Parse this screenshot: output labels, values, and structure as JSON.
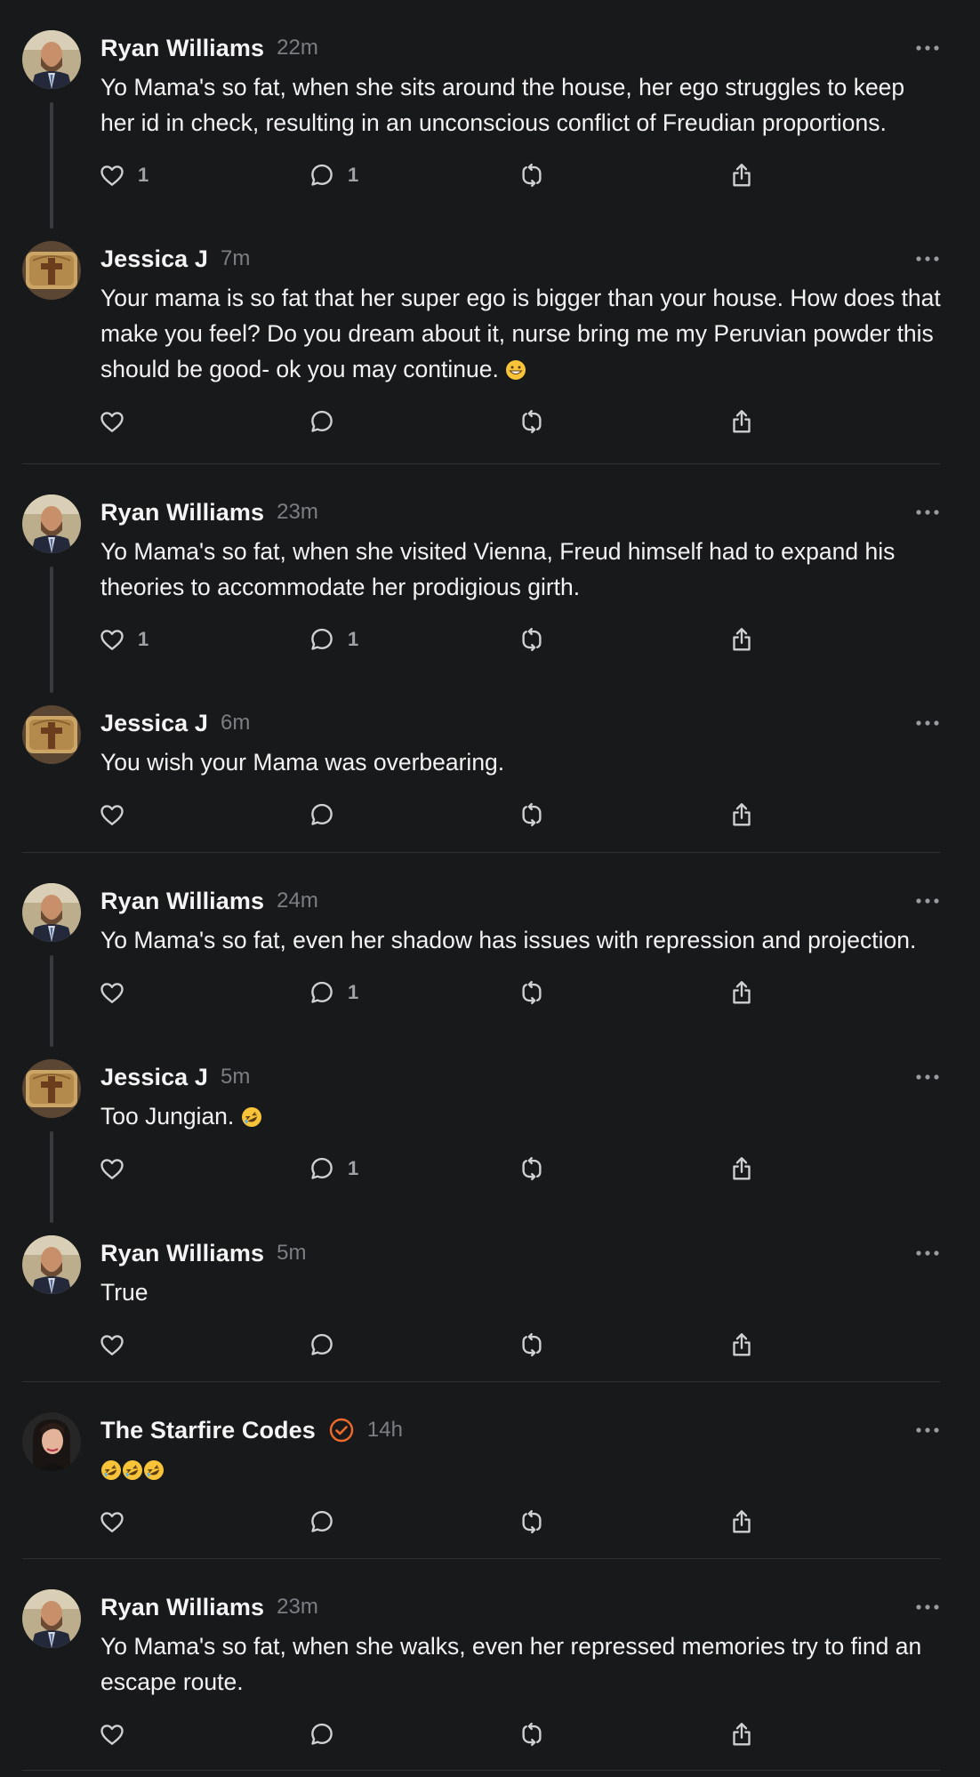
{
  "posts": [
    {
      "author": "Ryan Williams",
      "time": "22m",
      "text": "Yo Mama's so fat, when she sits around the house, her ego struggles to keep her id in check, resulting in an unconscious conflict of Freudian proportions.",
      "likes": "1",
      "replies": "1",
      "avatar": "man-portrait"
    },
    {
      "author": "Jessica J",
      "time": "7m",
      "text": "Your mama is so fat that her super ego is bigger than your house. How does that make you feel? Do you dream about it, nurse bring me my Peruvian powder this should be good- ok you may continue.",
      "likes": "",
      "replies": "",
      "avatar": "cross-plaque"
    },
    {
      "author": "Ryan Williams",
      "time": "23m",
      "text": "Yo Mama's so fat, when she visited Vienna, Freud himself had to expand his theories to accommodate her prodigious girth.",
      "likes": "1",
      "replies": "1",
      "avatar": "man-portrait"
    },
    {
      "author": "Jessica J",
      "time": "6m",
      "text": "You wish your Mama was overbearing.",
      "likes": "",
      "replies": "",
      "avatar": "cross-plaque"
    },
    {
      "author": "Ryan Williams",
      "time": "24m",
      "text": "Yo Mama's so fat, even her shadow has issues with repression and projection.",
      "likes": "",
      "replies": "1",
      "avatar": "man-portrait"
    },
    {
      "author": "Jessica J",
      "time": "5m",
      "text": "Too Jungian.",
      "likes": "",
      "replies": "1",
      "avatar": "cross-plaque"
    },
    {
      "author": "Ryan Williams",
      "time": "5m",
      "text": "True",
      "likes": "",
      "replies": "",
      "avatar": "man-portrait"
    },
    {
      "author": "The Starfire Codes",
      "time": "14h",
      "text": "",
      "likes": "",
      "replies": "",
      "avatar": "woman-portrait",
      "verified": true
    },
    {
      "author": "Ryan Williams",
      "time": "23m",
      "text": "Yo Mama's so fat, when she walks, even her repressed memories try to find an escape route.",
      "likes": "",
      "replies": "",
      "avatar": "man-portrait"
    }
  ],
  "icons": {
    "like": "heart-icon",
    "reply": "comment-icon",
    "repost": "repost-icon",
    "share": "share-icon",
    "more": "more-icon",
    "verified": "verified-badge-icon"
  },
  "colors": {
    "background": "#18191b",
    "verified": "#ef6a2b",
    "muted": "#7c7e82"
  }
}
